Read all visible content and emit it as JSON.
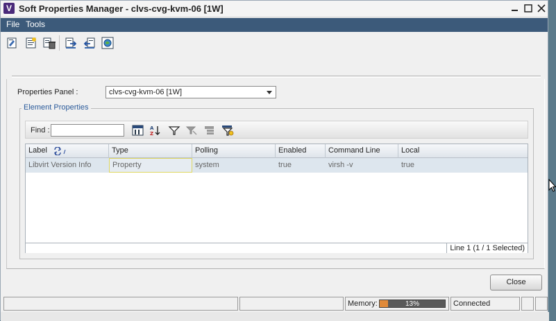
{
  "window": {
    "title": "Soft Properties Manager - clvs-cvg-kvm-06 [1W]",
    "logo_letter": "V"
  },
  "menu": {
    "items": [
      "File",
      "Tools"
    ]
  },
  "toolbar": {
    "icons": [
      "edit-property-icon",
      "new-property-icon",
      "delete-property-icon",
      "import-icon",
      "export-icon",
      "browse-icon"
    ]
  },
  "properties_panel": {
    "label": "Properties Panel :",
    "selected": "clvs-cvg-kvm-06 [1W]"
  },
  "element_properties": {
    "legend": "Element Properties",
    "find_label": "Find :",
    "find_value": "",
    "columns": [
      "Label",
      "Type",
      "Polling",
      "Enabled",
      "Command Line",
      "Local"
    ],
    "rows": [
      [
        "Libvirt Version Info",
        "Property",
        "system",
        "true",
        "virsh -v",
        "true"
      ]
    ],
    "status": "Line 1 (1 / 1 Selected)"
  },
  "buttons": {
    "close": "Close"
  },
  "statusbar": {
    "memory_label": "Memory:",
    "memory_percent": 13,
    "memory_text": "13%",
    "connection": "Connected"
  },
  "colors": {
    "menubar": "#3c5a7a",
    "memory_fill": "#e08a3a",
    "row_selected": "#dde6ee",
    "legend_text": "#2a5a9a"
  }
}
